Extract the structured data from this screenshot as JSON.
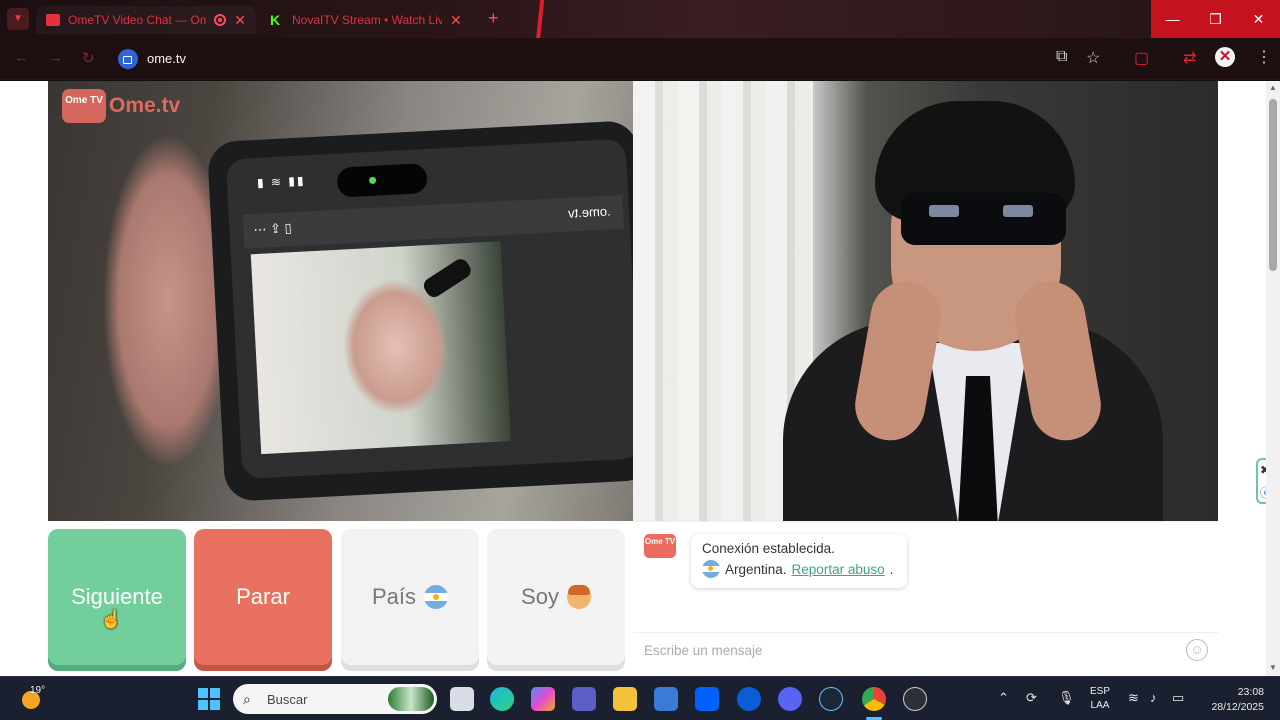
{
  "browser": {
    "tabs": [
      {
        "title": "OmeTV Video Chat — Ome",
        "recording": true
      },
      {
        "title": "NovaITV Stream • Watch Live o"
      }
    ],
    "url": "ome.tv",
    "icons": {
      "tab_menu": "chevron-down-icon",
      "close": "close-icon",
      "new_tab": "plus-icon",
      "back": "arrow-left-icon",
      "forward": "arrow-right-icon",
      "reload": "reload-icon",
      "cast": "cast-icon",
      "bookmark": "star-icon",
      "menu": "kebab-icon"
    },
    "window_controls": {
      "minimize": "—",
      "maximize": "❐",
      "close": "✕"
    }
  },
  "page": {
    "logo": {
      "badge": "Ome TV",
      "text": "Ome.tv"
    },
    "phone_url": ".ome.tv",
    "buttons": {
      "next": "Siguiente",
      "stop": "Parar",
      "country": "País",
      "gender": "Soy"
    },
    "colors": {
      "next": "#72cf9c",
      "stop": "#e9715f",
      "neutral": "#f2f2f2",
      "link": "#3aa58a"
    },
    "chat": {
      "logo_badge": "Ome TV",
      "status": "Conexión establecida.",
      "country": "Argentina.",
      "report_link": "Reportar abuso",
      "report_suffix": ".",
      "input_placeholder": "Escribe un mensaje"
    }
  },
  "taskbar": {
    "weather_temp": "19°",
    "search_placeholder": "Buscar",
    "lang_line1": "ESP",
    "lang_line2": "LAA",
    "time": "23:08",
    "date": "28/12/2025"
  }
}
